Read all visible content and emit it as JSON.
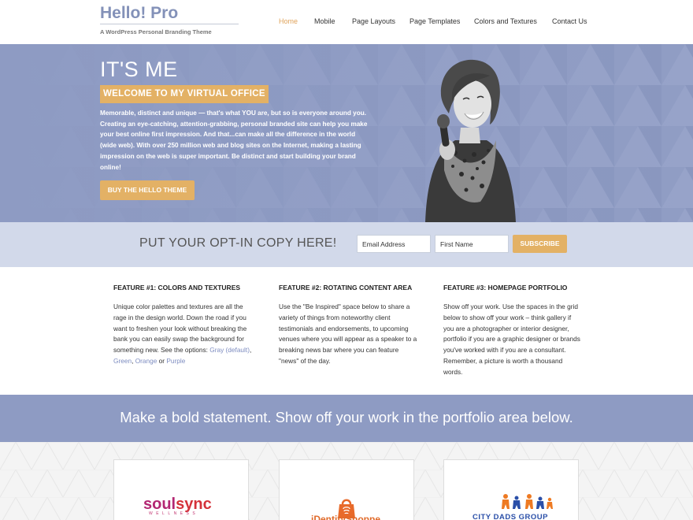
{
  "header": {
    "title": "Hello! Pro",
    "description": "A WordPress Personal Branding Theme"
  },
  "nav": {
    "items": [
      {
        "label": "Home",
        "active": true
      },
      {
        "label": "Mobile"
      },
      {
        "label": "Page Layouts"
      },
      {
        "label": "Page Templates"
      },
      {
        "label": "Colors and Textures"
      },
      {
        "label": "Contact Us"
      }
    ]
  },
  "hero": {
    "heading": "IT'S ME",
    "subheading": "WELCOME TO MY VIRTUAL OFFICE",
    "text": "Memorable, distinct and unique — that's what YOU are, but so is everyone around you. Creating an eye-catching, attention-grabbing, personal branded site can help you make your best online first impression. And that...can make all the difference in the world (wide web). With over 250 million web and blog sites on the Internet, making a lasting impression on the web is super important. Be distinct and start building your brand online!",
    "button": "BUY THE HELLO THEME"
  },
  "optin": {
    "title": "PUT YOUR OPT-IN COPY HERE!",
    "email_placeholder": "Email Address",
    "name_placeholder": "First Name",
    "button": "SUBSCRIBE"
  },
  "features": [
    {
      "title": "FEATURE #1: COLORS AND TEXTURES",
      "text_before": "Unique color palettes and textures are all the rage in the design world. Down the road if you want to freshen your look without breaking the bank you can easily swap the background for something new. See the options: ",
      "link1": "Gray (default)",
      "sep1": ", ",
      "link2": "Green",
      "sep2": ", ",
      "link3": "Orange",
      "sep3": " or ",
      "link4": "Purple"
    },
    {
      "title": "FEATURE #2: ROTATING CONTENT AREA",
      "text": "Use the \"Be Inspired\" space below to share a variety of things from noteworthy client testimonials and endorsements, to upcoming venues where you will appear as a speaker to a breaking news bar where you can feature \"news\" of the day."
    },
    {
      "title": "FEATURE #3: HOMEPAGE PORTFOLIO",
      "text": "Show off your work. Use the spaces in the grid below to show off your work – think gallery if you are a photographer or interior designer, portfolio if you are a graphic designer or brands you've worked with if you are a consultant. Remember, a picture is worth a thousand words."
    }
  ],
  "statement": {
    "text": "Make a bold statement. Show off your work in the portfolio area below."
  },
  "portfolio": {
    "items": [
      {
        "logo_part1": "soul",
        "logo_part2": "sync",
        "logo_sub": "WELLNESS"
      },
      {
        "logo": "iDentityShoppe"
      },
      {
        "logo": "CITY DADS GROUP"
      }
    ]
  },
  "colors": {
    "accent": "#e3b165",
    "brand_blue": "#8e9bc3",
    "optin_bg": "#d2d9ea",
    "link": "#7d8cc0"
  }
}
